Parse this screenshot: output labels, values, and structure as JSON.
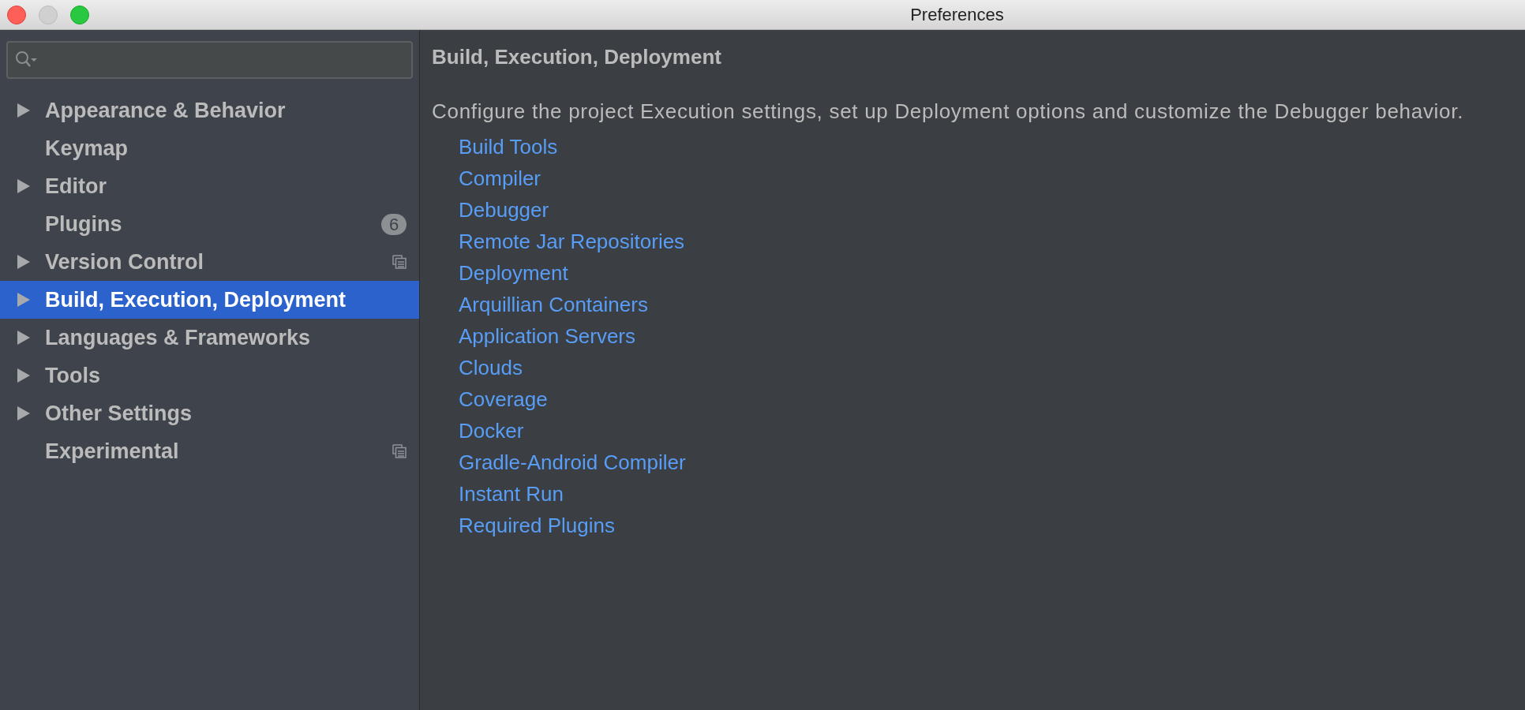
{
  "window": {
    "title": "Preferences"
  },
  "sidebar": {
    "items": [
      {
        "label": "Appearance & Behavior",
        "expandable": true,
        "selected": false,
        "project_icon": false
      },
      {
        "label": "Keymap",
        "expandable": false,
        "selected": false,
        "project_icon": false
      },
      {
        "label": "Editor",
        "expandable": true,
        "selected": false,
        "project_icon": false
      },
      {
        "label": "Plugins",
        "expandable": false,
        "selected": false,
        "project_icon": false,
        "badge": "6"
      },
      {
        "label": "Version Control",
        "expandable": true,
        "selected": false,
        "project_icon": true
      },
      {
        "label": "Build, Execution, Deployment",
        "expandable": true,
        "selected": true,
        "project_icon": false
      },
      {
        "label": "Languages & Frameworks",
        "expandable": true,
        "selected": false,
        "project_icon": false
      },
      {
        "label": "Tools",
        "expandable": true,
        "selected": false,
        "project_icon": false
      },
      {
        "label": "Other Settings",
        "expandable": true,
        "selected": false,
        "project_icon": false
      },
      {
        "label": "Experimental",
        "expandable": false,
        "selected": false,
        "project_icon": true
      }
    ]
  },
  "content": {
    "heading": "Build, Execution, Deployment",
    "description": "Configure the project Execution settings, set up Deployment options and customize the Debugger behavior.",
    "links": [
      "Build Tools",
      "Compiler",
      "Debugger",
      "Remote Jar Repositories",
      "Deployment",
      "Arquillian Containers",
      "Application Servers",
      "Clouds",
      "Coverage",
      "Docker",
      "Gradle-Android Compiler",
      "Instant Run",
      "Required Plugins"
    ]
  }
}
